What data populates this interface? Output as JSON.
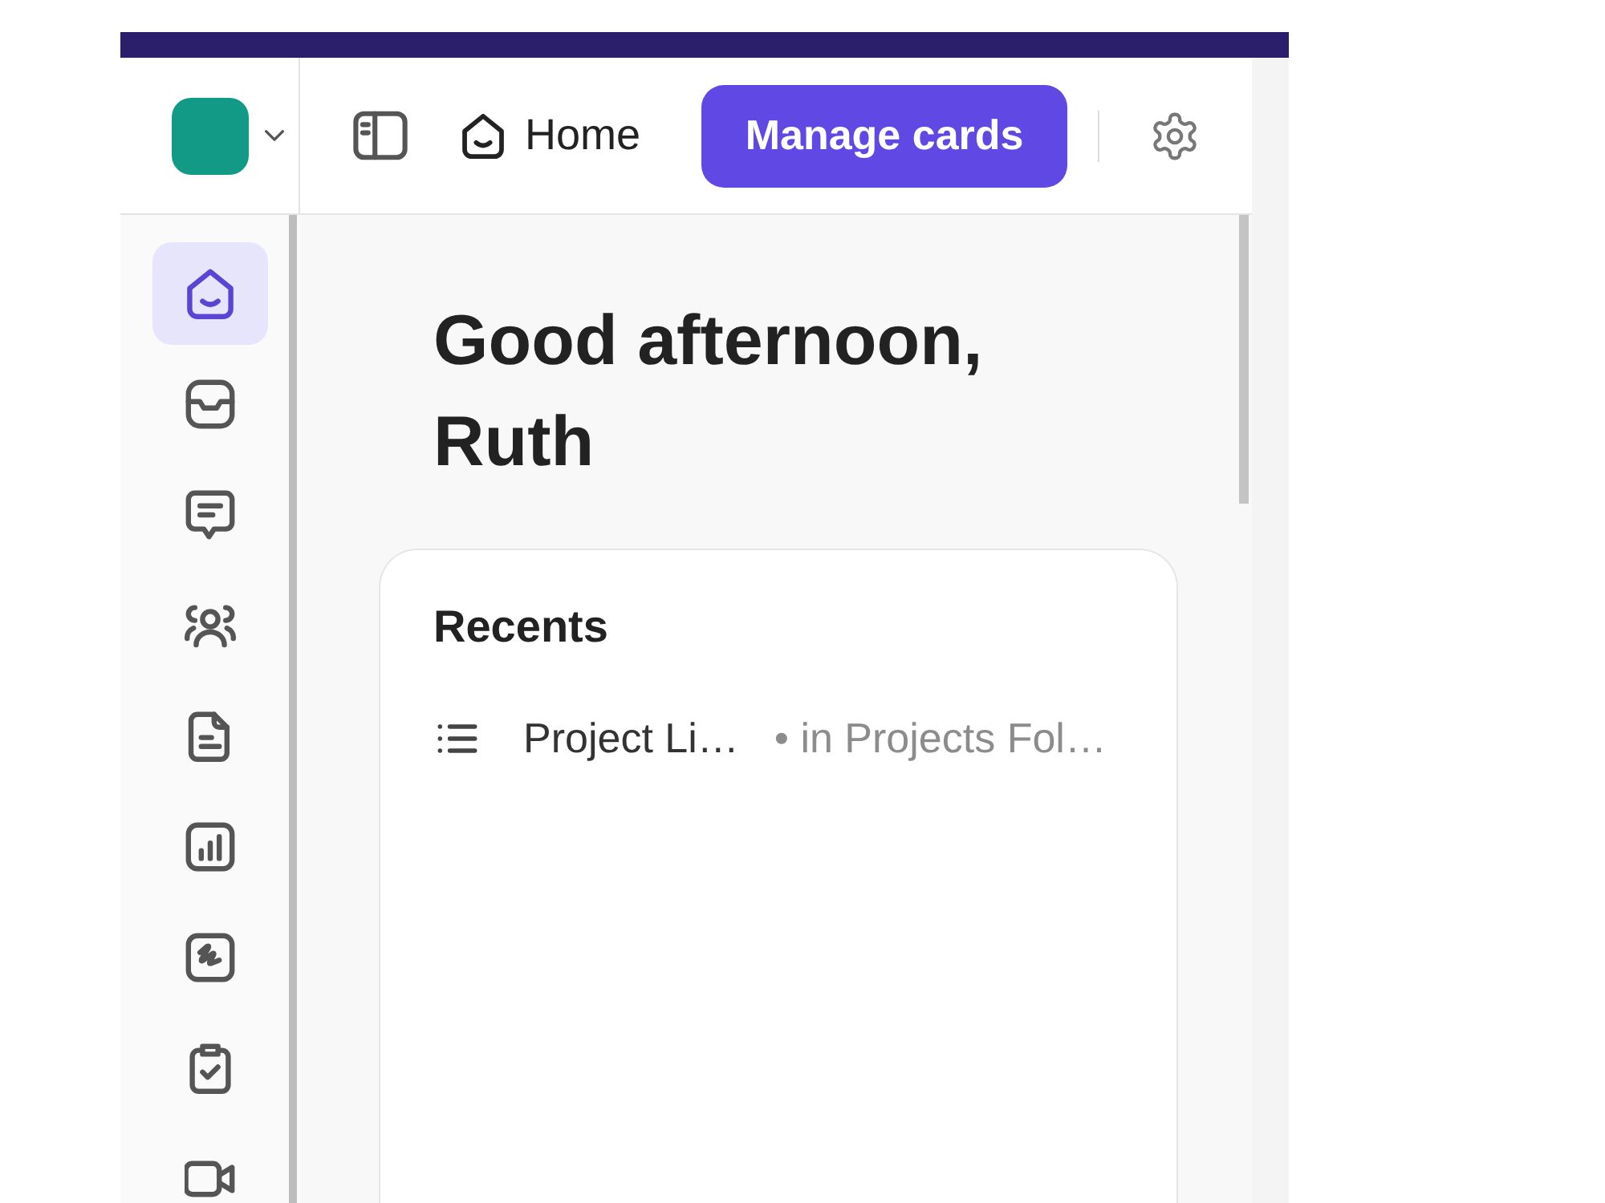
{
  "header": {
    "home_tab": {
      "label": "Home"
    },
    "primary_button": {
      "label": "Manage cards"
    }
  },
  "sidebar": {
    "items": [
      {
        "kind": "home",
        "selected": true
      },
      {
        "kind": "inbox",
        "selected": false
      },
      {
        "kind": "chat",
        "selected": false
      },
      {
        "kind": "people",
        "selected": false
      },
      {
        "kind": "document",
        "selected": false
      },
      {
        "kind": "chart",
        "selected": false
      },
      {
        "kind": "whiteboard",
        "selected": false
      },
      {
        "kind": "tasks",
        "selected": false
      },
      {
        "kind": "video",
        "selected": false
      }
    ]
  },
  "greeting": "Good afternoon, Ruth",
  "recents": {
    "title": "Recents",
    "items": [
      {
        "kind": "list",
        "name": "Project Li…",
        "location": "• in Projects Fol…"
      }
    ]
  }
}
